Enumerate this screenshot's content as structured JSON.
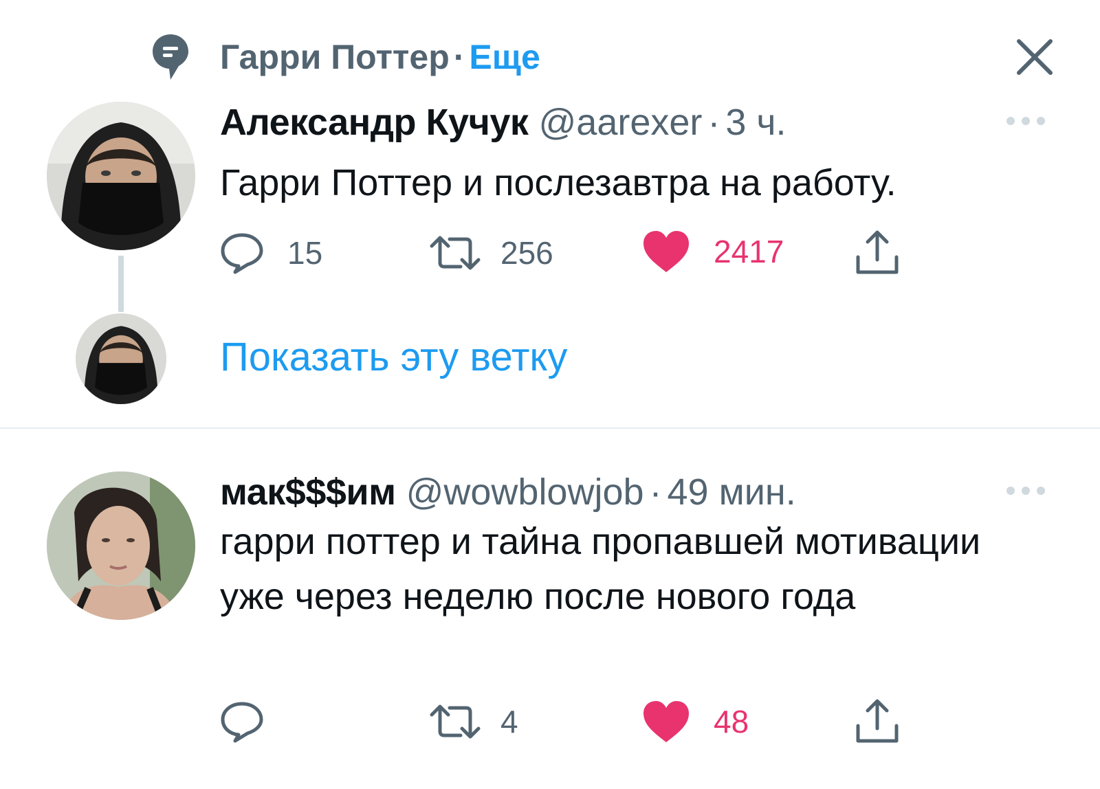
{
  "header": {
    "topic": "Гарри Поттер",
    "separator": "·",
    "more": "Еще",
    "icons": {
      "topic": "topic-bubble-icon",
      "close": "close-icon"
    }
  },
  "tweets": [
    {
      "author_name": "Александр Кучук",
      "handle": "@aarexer",
      "dot": "·",
      "time": "3 ч.",
      "text": "Гарри Поттер и послезавтра на работу.",
      "replies": "15",
      "retweets": "256",
      "likes": "2417",
      "liked": true
    },
    {
      "author_name": "мак$$$им",
      "handle": "@wowblowjob",
      "dot": "·",
      "time": "49 мин.",
      "text": "гарри поттер и тайна пропавшей мотивации уже через неделю после нового года",
      "replies": "",
      "retweets": "4",
      "likes": "48",
      "liked": true
    }
  ],
  "thread": {
    "show_label": "Показать эту ветку"
  },
  "colors": {
    "accent": "#1d9bf0",
    "like": "#e8336f",
    "muted": "#536471",
    "text": "#0f1419"
  }
}
